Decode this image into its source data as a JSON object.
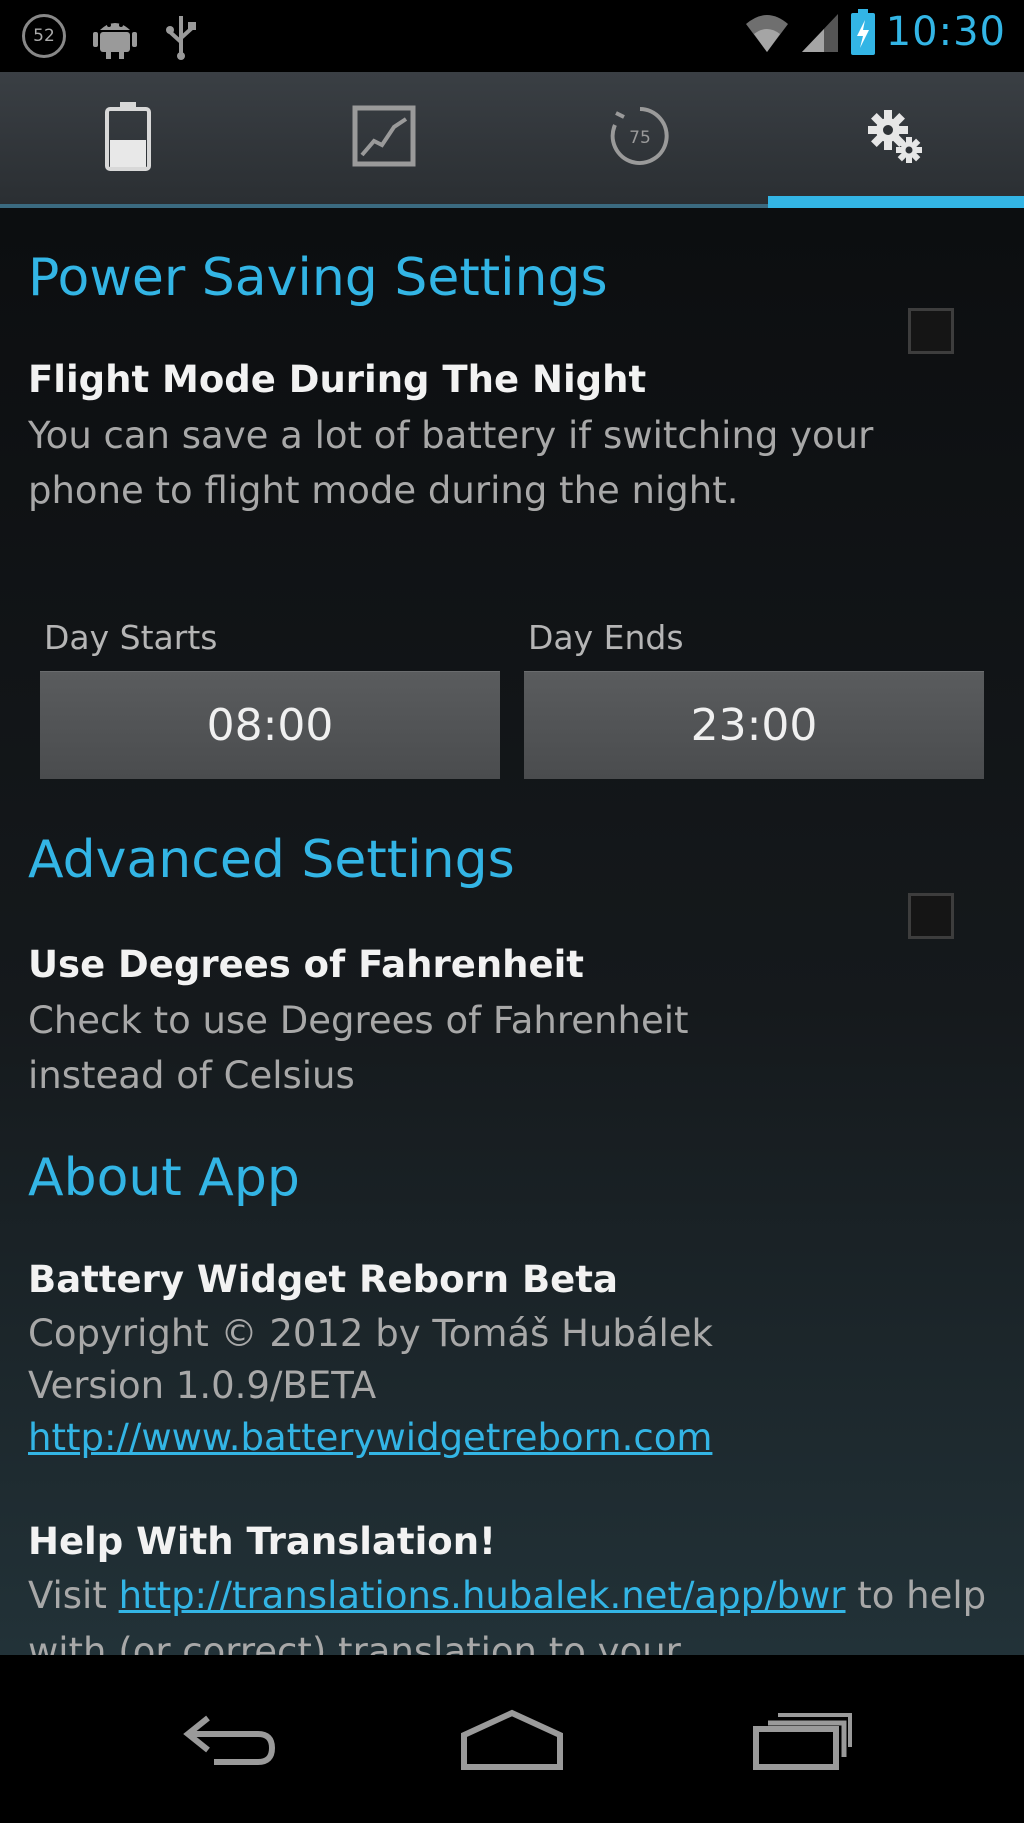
{
  "status_bar": {
    "notification_count": "52",
    "time": "10:30",
    "icons": [
      "notification-count-icon",
      "android-debug-icon",
      "usb-icon",
      "wifi-icon",
      "signal-icon",
      "battery-charging-icon"
    ]
  },
  "tabs": [
    {
      "id": "battery",
      "icon": "battery-icon",
      "selected": false
    },
    {
      "id": "graph",
      "icon": "graph-icon",
      "selected": false
    },
    {
      "id": "gauge",
      "icon": "gauge-icon",
      "icon_text": "75",
      "selected": false
    },
    {
      "id": "settings",
      "icon": "gear-icon",
      "selected": true
    }
  ],
  "power_saving": {
    "title": "Power Saving Settings",
    "flight_mode": {
      "title": "Flight Mode During The Night",
      "summary": "You can save a lot of battery if switching your phone to flight mode during the night.",
      "checked": false
    },
    "day_starts_label": "Day Starts",
    "day_starts_value": "08:00",
    "day_ends_label": "Day Ends",
    "day_ends_value": "23:00"
  },
  "advanced": {
    "title": "Advanced Settings",
    "fahrenheit": {
      "title": "Use Degrees of Fahrenheit",
      "summary": "Check to use Degrees of Fahrenheit instead of Celsius",
      "checked": false
    }
  },
  "about": {
    "title": "About App",
    "app_name": "Battery Widget Reborn Beta",
    "copyright": "Copyright © 2012 by Tomáš Hubálek",
    "version": "Version 1.0.9/BETA",
    "website": "http://www.batterywidgetreborn.com",
    "help_title": "Help With Translation!",
    "help_prefix": "Visit ",
    "help_link": "http://translations.hubalek.net/app/bwr",
    "help_suffix": " to help with (or correct) translation to your"
  },
  "nav_bar": {
    "buttons": [
      "back-icon",
      "home-icon",
      "recent-apps-icon"
    ]
  }
}
